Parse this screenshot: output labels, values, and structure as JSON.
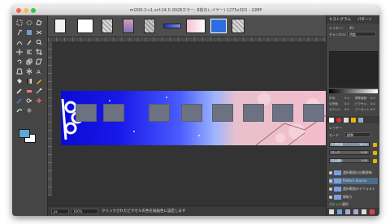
{
  "window": {
    "title": "ml200-2-c1.xcf-24.0 (RGBカラー, 8枚のレイヤー) 1275x303 – GIMP"
  },
  "toolbox": {
    "tools": [
      {
        "name": "rect-select-tool-icon"
      },
      {
        "name": "ellipse-select-tool-icon"
      },
      {
        "name": "free-select-tool-icon"
      },
      {
        "name": "fuzzy-select-tool-icon"
      },
      {
        "name": "color-select-tool-icon"
      },
      {
        "name": "scissors-tool-icon"
      },
      {
        "name": "paths-tool-icon"
      },
      {
        "name": "color-picker-tool-icon"
      },
      {
        "name": "zoom-tool-icon"
      },
      {
        "name": "move-tool-icon"
      },
      {
        "name": "align-tool-icon"
      },
      {
        "name": "crop-tool-icon"
      },
      {
        "name": "rotate-tool-icon"
      },
      {
        "name": "scale-tool-icon"
      },
      {
        "name": "shear-tool-icon"
      },
      {
        "name": "perspective-tool-icon"
      },
      {
        "name": "flip-tool-icon"
      },
      {
        "name": "text-tool-icon"
      },
      {
        "name": "bucket-fill-tool-icon"
      },
      {
        "name": "blend-tool-icon"
      },
      {
        "name": "pencil-tool-icon"
      },
      {
        "name": "paintbrush-tool-icon"
      },
      {
        "name": "eraser-tool-icon"
      },
      {
        "name": "airbrush-tool-icon"
      },
      {
        "name": "ink-tool-icon"
      },
      {
        "name": "clone-tool-icon"
      },
      {
        "name": "heal-tool-icon"
      },
      {
        "name": "smudge-tool-icon"
      },
      {
        "name": "dodge-burn-tool-icon"
      }
    ],
    "colors": {
      "fg": "#5aa8d8",
      "bg": "#ffffff"
    }
  },
  "status": {
    "unit": "px",
    "zoom": "100%",
    "message": "クリックされたピクセルの色を描画色に設定します"
  },
  "dock": {
    "tab_histogram": "ヒストグラム",
    "tab_palette": "パターン",
    "layer_label": "レイヤー:",
    "layer_value": "#1",
    "channel_label": "チャンネル:",
    "channel_value": "明度",
    "stats": [
      {
        "label": "平均:",
        "value": "0.0"
      },
      {
        "label": "標準偏差:",
        "value": "0.0"
      },
      {
        "label": "中央値:",
        "value": "0.0"
      },
      {
        "label": "ピクセル:",
        "value": "0.0"
      },
      {
        "label": "カウント:",
        "value": "0.0"
      },
      {
        "label": "パーセント:",
        "value": "0.0"
      }
    ],
    "layers_section_label": "レイヤー",
    "mode_label": "モード",
    "mode_value": "標準",
    "sliders": [
      {
        "label": "不透明度",
        "value": "100.0",
        "fill": 1.0
      },
      {
        "label": "ロック",
        "value": "0.00",
        "fill": 0.0
      },
      {
        "label": "拡大縮小",
        "value": "1.00",
        "fill": 0.3
      }
    ],
    "layers": [
      {
        "name": "選択範囲の自動更新",
        "selected": false
      },
      {
        "name": "Pattern Source",
        "selected": true
      },
      {
        "name": "選択範囲のデフォルト",
        "selected": false
      },
      {
        "name": "縁取り",
        "selected": false
      }
    ],
    "footer_label": "パレット選択"
  }
}
